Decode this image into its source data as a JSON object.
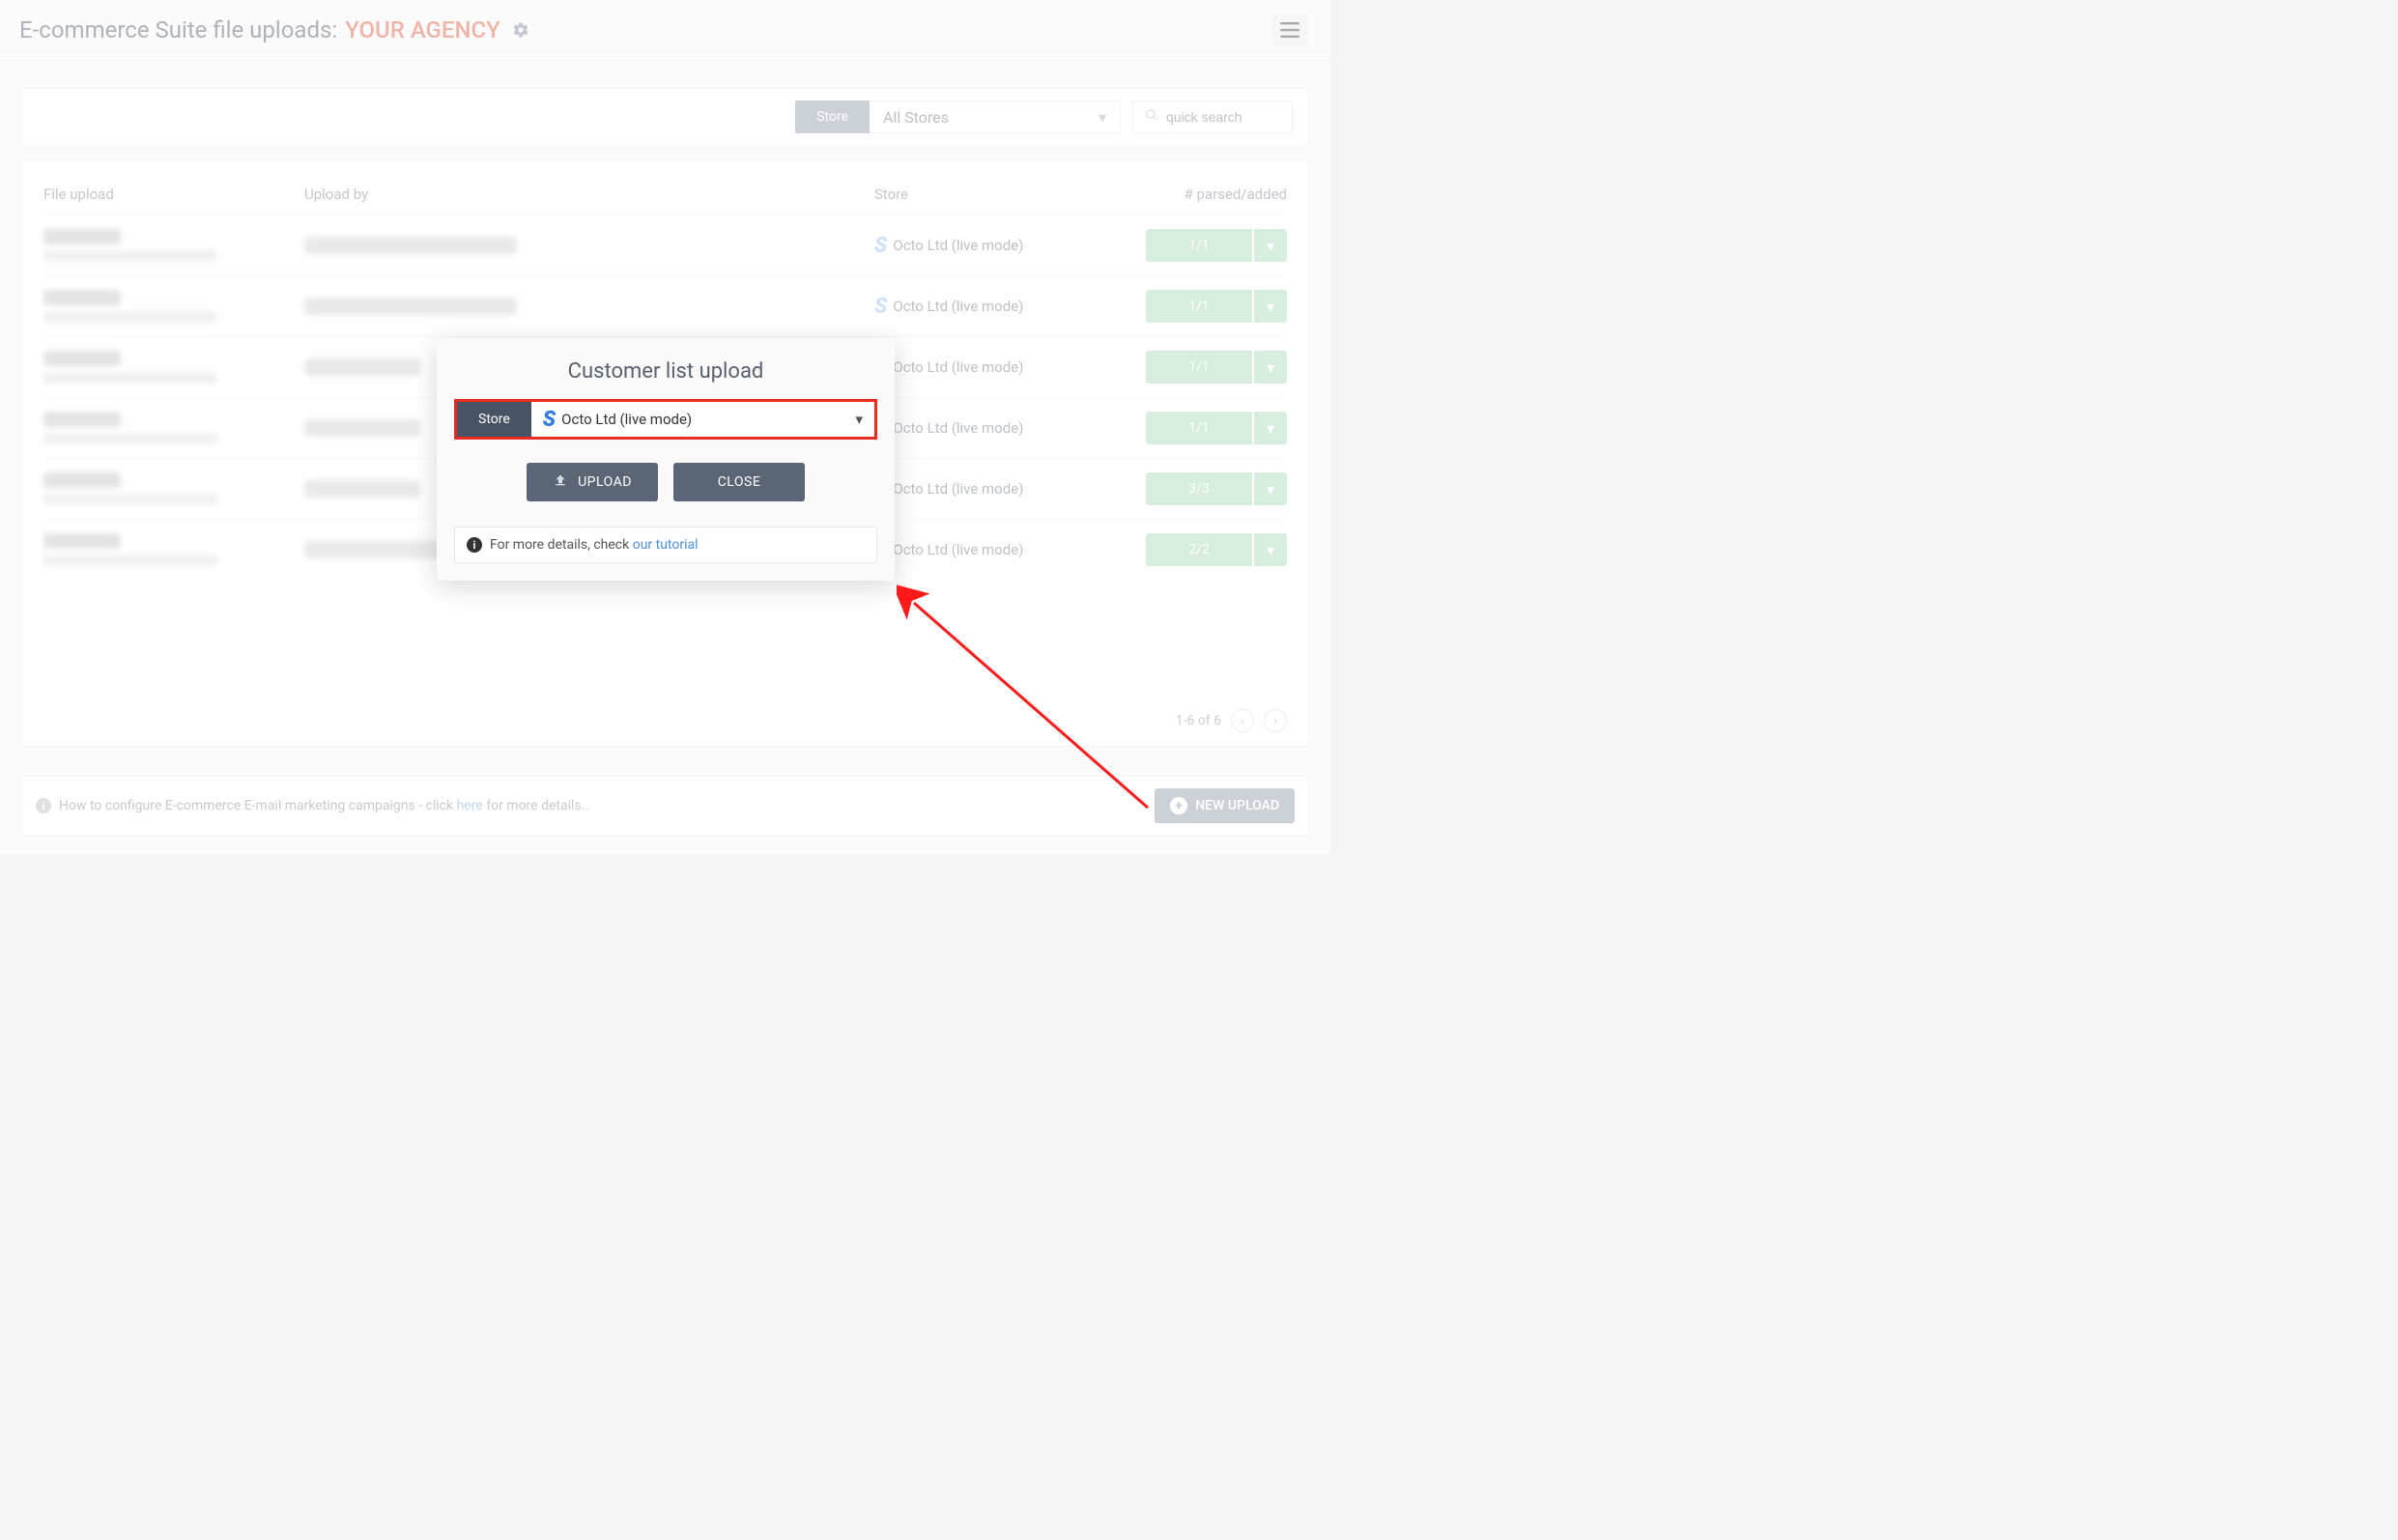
{
  "header": {
    "title_prefix": "E-commerce Suite file uploads:",
    "agency": "YOUR AGENCY"
  },
  "toolbar": {
    "store_label": "Store",
    "store_value": "All Stores",
    "search_placeholder": "quick search"
  },
  "columns": {
    "file": "File upload",
    "by": "Upload by",
    "store": "Store",
    "badge": "# parsed/added"
  },
  "rows": [
    {
      "store": "Octo Ltd (live mode)",
      "badge": "1/1",
      "by_width": 220
    },
    {
      "store": "Octo Ltd (live mode)",
      "badge": "1/1",
      "by_width": 220
    },
    {
      "store": "Octo Ltd (live mode)",
      "badge": "1/1",
      "by_width": 120
    },
    {
      "store": "Octo Ltd (live mode)",
      "badge": "1/1",
      "by_width": 120
    },
    {
      "store": "Octo Ltd (live mode)",
      "badge": "3/3",
      "by_width": 120
    },
    {
      "store": "Octo Ltd (live mode)",
      "badge": "2/2",
      "by_width": 140
    }
  ],
  "pager": {
    "text": "1-6 of 6"
  },
  "footer": {
    "text_before": "How to configure E-commerce E-mail marketing campaigns - click ",
    "link": "here",
    "text_after": " for more details…",
    "new_upload": "NEW UPLOAD"
  },
  "modal": {
    "title": "Customer list upload",
    "store_label": "Store",
    "store_value": "Octo Ltd (live mode)",
    "upload": "UPLOAD",
    "close": "CLOSE",
    "footer_text": "For more details, check ",
    "footer_link": "our tutorial"
  }
}
